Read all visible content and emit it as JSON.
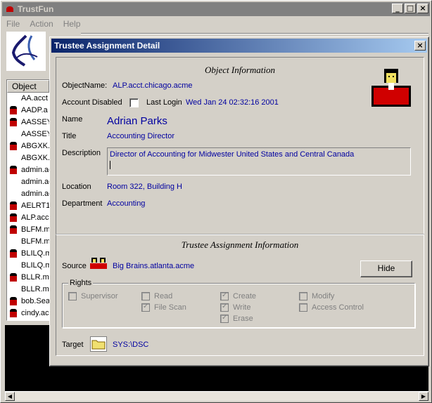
{
  "window": {
    "title": "TrustFun",
    "buttons": {
      "minimize": "_",
      "maximize": "□",
      "close": "×"
    }
  },
  "menu": [
    "File",
    "Action",
    "Help"
  ],
  "object_list": {
    "header": "Object",
    "items": [
      {
        "label": "AA.acct",
        "type": "object"
      },
      {
        "label": "AADP.a",
        "type": "user"
      },
      {
        "label": "AASSEY",
        "type": "user"
      },
      {
        "label": "AASSEY",
        "type": "object"
      },
      {
        "label": "ABGXK.",
        "type": "user"
      },
      {
        "label": "ABGXK.",
        "type": "object"
      },
      {
        "label": "admin.ac",
        "type": "user"
      },
      {
        "label": "admin.ac",
        "type": "object"
      },
      {
        "label": "admin.ac",
        "type": "object"
      },
      {
        "label": "AELRT1",
        "type": "user"
      },
      {
        "label": "ALP.acc",
        "type": "user"
      },
      {
        "label": "BLFM.m",
        "type": "user"
      },
      {
        "label": "BLFM.m",
        "type": "object"
      },
      {
        "label": "BLILQ.m",
        "type": "user"
      },
      {
        "label": "BLILQ.m",
        "type": "object"
      },
      {
        "label": "BLLR.m",
        "type": "user"
      },
      {
        "label": "BLLR.m",
        "type": "object"
      },
      {
        "label": "bob.Sea",
        "type": "user"
      },
      {
        "label": "cindy.ac",
        "type": "user"
      }
    ]
  },
  "dialog": {
    "title": "Trustee Assignment Detail",
    "close": "×",
    "object_info": {
      "section_title": "Object Information",
      "object_name_label": "ObjectName:",
      "object_name": "ALP.acct.chicago.acme",
      "account_disabled_label": "Account Disabled",
      "last_login_label": "Last Login",
      "last_login": "Wed Jan 24 02:32:16 2001",
      "name_label": "Name",
      "name": "Adrian Parks",
      "title_label": "Title",
      "title": "Accounting Director",
      "description_label": "Description",
      "description": "Director of Accounting for Midwester United States and Central Canada",
      "location_label": "Location",
      "location": "Room 322, Building H",
      "department_label": "Department",
      "department": "Accounting"
    },
    "trustee_info": {
      "section_title": "Trustee Assignment Information",
      "source_label": "Source",
      "source": "Big Brains.atlanta.acme",
      "hide_button": "Hide",
      "rights_label": "Rights",
      "rights": [
        {
          "label": "Supervisor",
          "checked": false
        },
        {
          "label": "Read",
          "checked": false
        },
        {
          "label": "File Scan",
          "checked": true
        },
        {
          "label": "Create",
          "checked": true
        },
        {
          "label": "Write",
          "checked": true
        },
        {
          "label": "Erase",
          "checked": true
        },
        {
          "label": "Modify",
          "checked": false
        },
        {
          "label": "Access Control",
          "checked": false
        }
      ],
      "target_label": "Target",
      "target": "SYS:\\DSC"
    }
  },
  "colors": {
    "value_text": "#0000a0",
    "title_gradient_start": "#0a246a",
    "title_gradient_end": "#a6caf0",
    "user_icon": "#c00000"
  }
}
